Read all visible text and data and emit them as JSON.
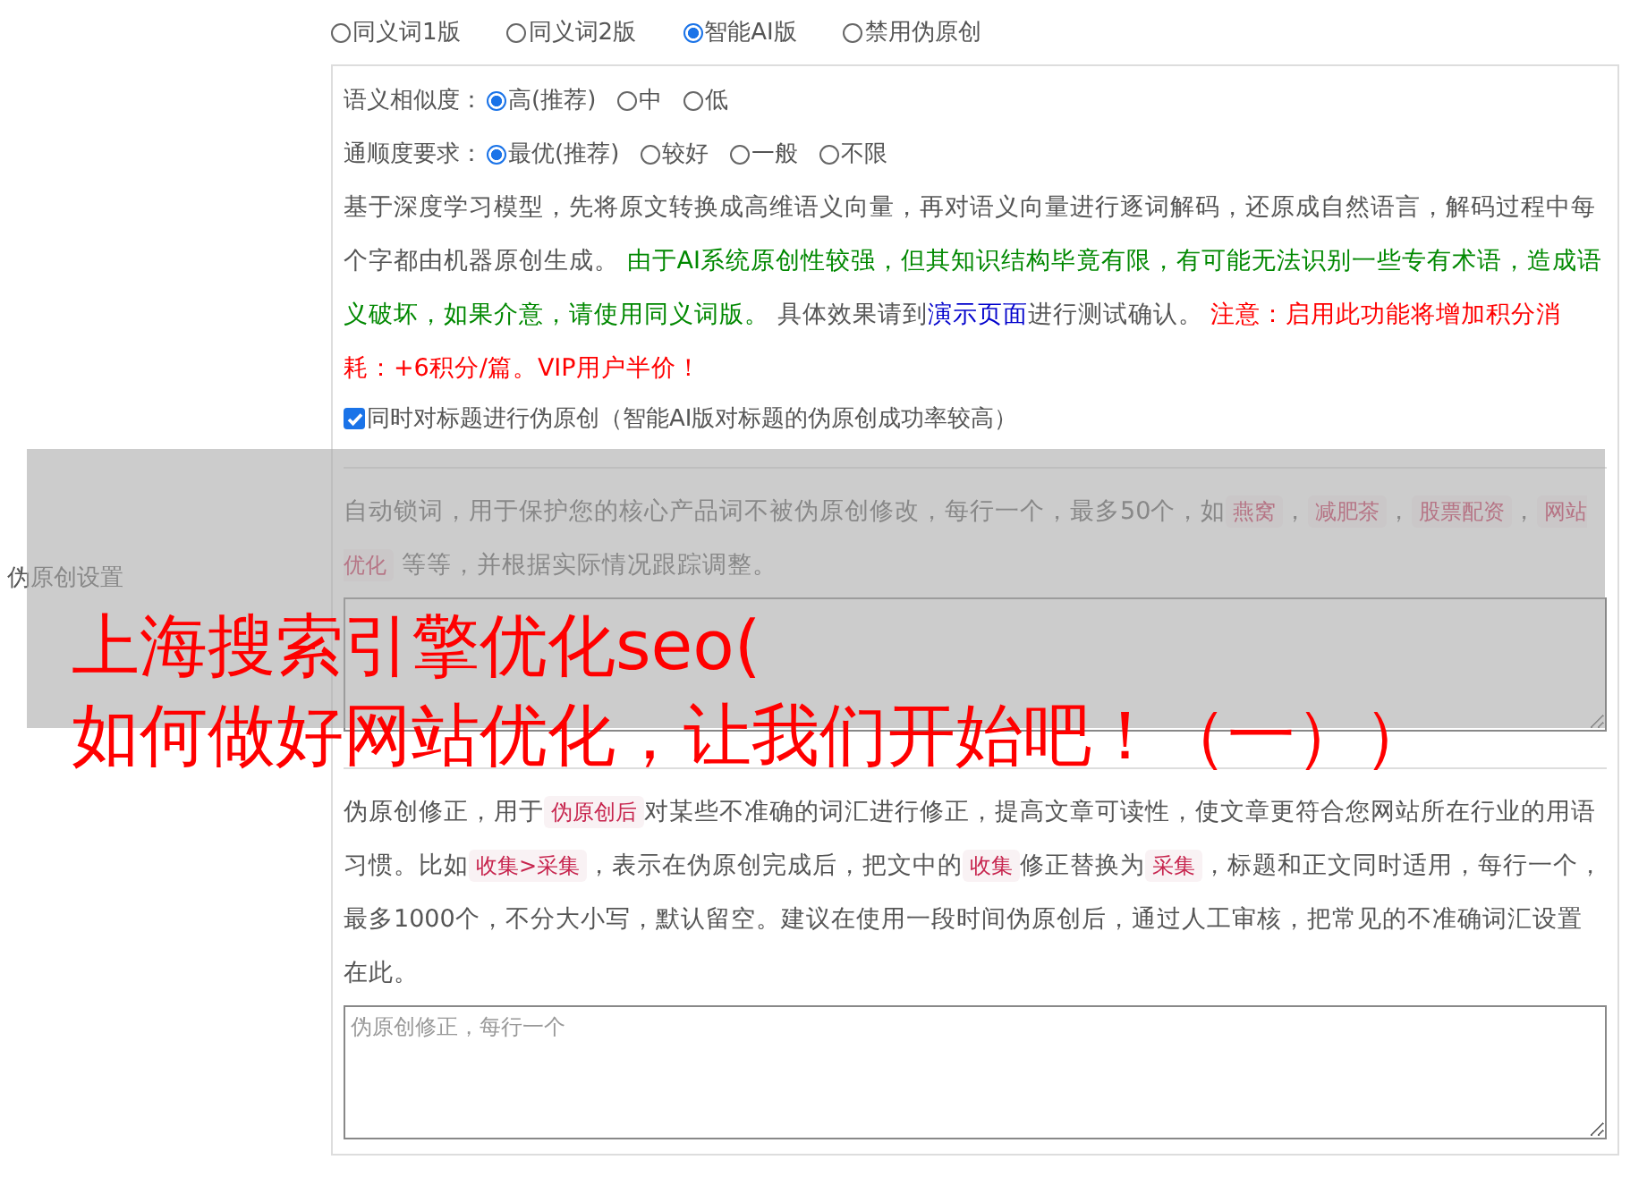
{
  "section_label": "伪原创设置",
  "modes": [
    {
      "label": "同义词1版",
      "selected": false
    },
    {
      "label": "同义词2版",
      "selected": false
    },
    {
      "label": "智能AI版",
      "selected": true
    },
    {
      "label": "禁用伪原创",
      "selected": false
    }
  ],
  "option_groups": [
    {
      "label": "语义相似度：",
      "options": [
        {
          "label": "高(推荐)",
          "selected": true
        },
        {
          "label": "中",
          "selected": false
        },
        {
          "label": "低",
          "selected": false
        }
      ]
    },
    {
      "label": "通顺度要求：",
      "options": [
        {
          "label": "最优(推荐)",
          "selected": true
        },
        {
          "label": "较好",
          "selected": false
        },
        {
          "label": "一般",
          "selected": false
        },
        {
          "label": "不限",
          "selected": false
        }
      ]
    }
  ],
  "ai_description": [
    {
      "kind": "plain",
      "text": "基于深度学习模型，先将原文转换成高维语义向量，再对语义向量进行逐词解码，还原成自然语言，解码过程中每个字都由机器原创生成。 "
    },
    {
      "kind": "note",
      "text": "由于AI系统原创性较强，但其知识结构毕竟有限，有可能无法识别一些专有术语，造成语义破坏，如果介意，请使用同义词版。"
    },
    {
      "kind": "plain",
      "text": " 具体效果请到"
    },
    {
      "kind": "link",
      "text": "演示页面"
    },
    {
      "kind": "plain",
      "text": "进行测试确认。 "
    },
    {
      "kind": "warning",
      "text": "注意：启用此功能将增加积分消耗：+6积分/篇。VIP用户半价！"
    }
  ],
  "title_checkbox": {
    "label": "同时对标题进行伪原创（智能AI版对标题的伪原创成功率较高）",
    "checked": true
  },
  "lock_words": {
    "description": [
      {
        "kind": "plain",
        "text": "自动锁词，用于保护您的核心产品词不被伪原创修改，每行一个，最多50个，如"
      },
      {
        "kind": "code",
        "text": "燕窝"
      },
      {
        "kind": "plain",
        "text": "，"
      },
      {
        "kind": "code",
        "text": "减肥茶"
      },
      {
        "kind": "plain",
        "text": "，"
      },
      {
        "kind": "code",
        "text": "股票配资"
      },
      {
        "kind": "plain",
        "text": "，"
      },
      {
        "kind": "code",
        "text": "网站优化"
      },
      {
        "kind": "plain",
        "text": " 等等，并根据实际情况跟踪调整。"
      }
    ]
  },
  "corrections": {
    "description": [
      {
        "kind": "plain",
        "text": "伪原创修正，用于"
      },
      {
        "kind": "code",
        "text": "伪原创后"
      },
      {
        "kind": "plain",
        "text": "对某些不准确的词汇进行修正，提高文章可读性，使文章更符合您网站所在行业的用语习惯。比如"
      },
      {
        "kind": "code",
        "text": "收集>采集"
      },
      {
        "kind": "plain",
        "text": "，表示在伪原创完成后，把文中的"
      },
      {
        "kind": "code",
        "text": "收集"
      },
      {
        "kind": "plain",
        "text": "修正替换为"
      },
      {
        "kind": "code",
        "text": "采集"
      },
      {
        "kind": "plain",
        "text": "，标题和正文同时适用，每行一个，最多1000个，不分大小写，默认留空。建议在使用一段时间伪原创后，通过人工审核，把常见的不准确词汇设置在此。"
      }
    ],
    "placeholder": "伪原创修正，每行一个"
  },
  "overlay_title": [
    "上海搜索引擎优化seo(",
    "如何做好网站优化，让我们开始吧！（一））"
  ]
}
